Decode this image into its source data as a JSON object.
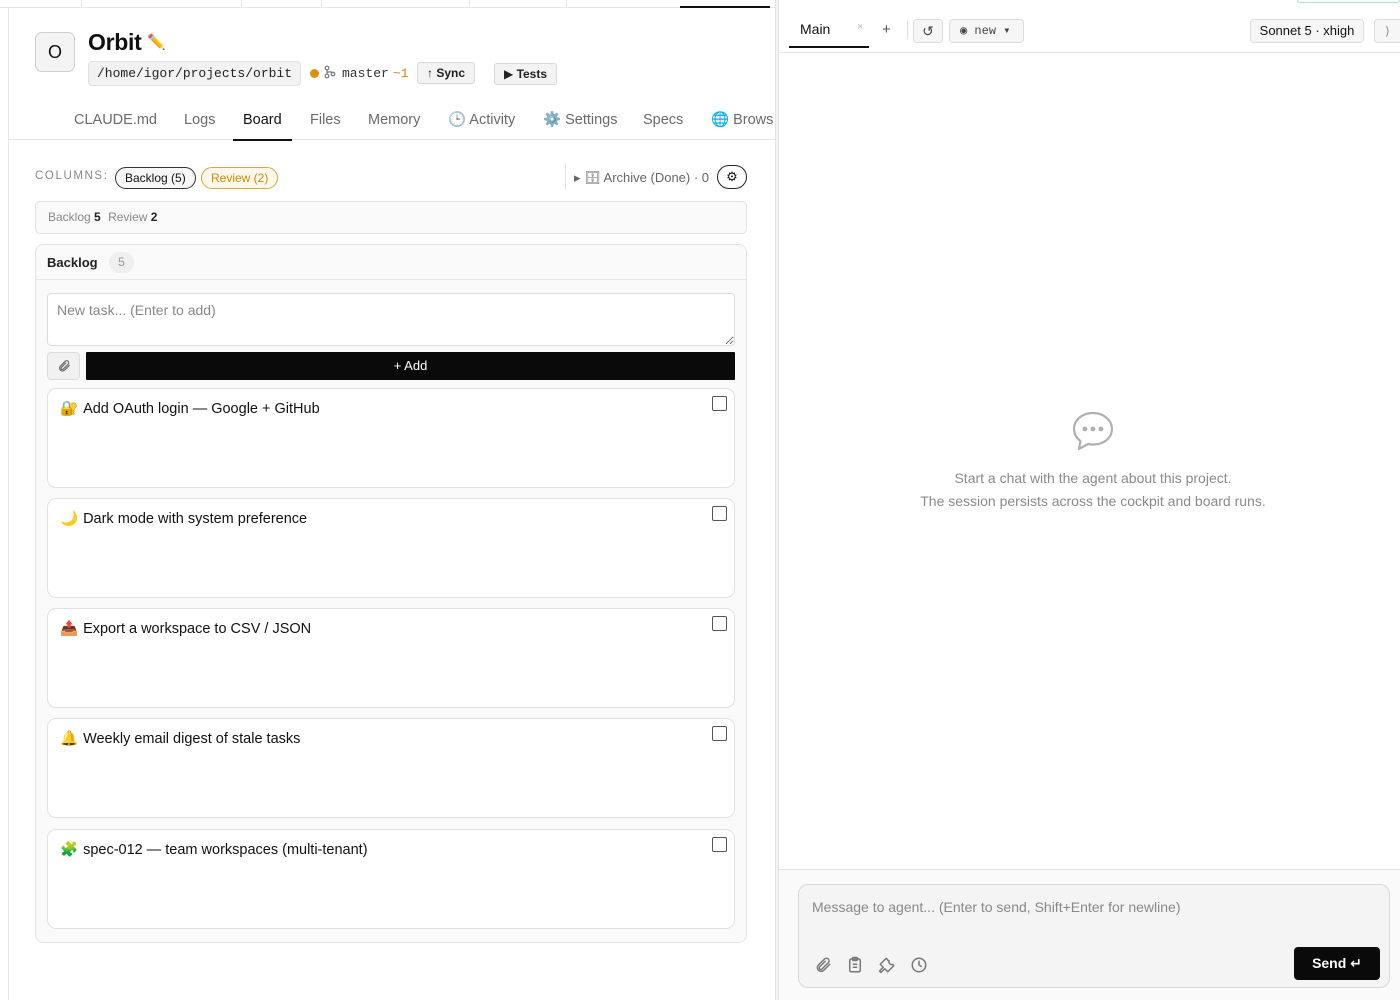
{
  "project": {
    "avatar_letter": "O",
    "name": "Orbit",
    "path": "/home/igor/projects/orbit",
    "branch": "master",
    "branch_ahead": "~1",
    "sync_label": "↑ Sync",
    "tests_label": "▶ Tests"
  },
  "tabs": [
    {
      "label": "CLAUDE.md"
    },
    {
      "label": "Logs"
    },
    {
      "label": "Board",
      "active": true
    },
    {
      "label": "Files"
    },
    {
      "label": "Memory"
    },
    {
      "label": "🕒 Activity"
    },
    {
      "label": "⚙️ Settings"
    },
    {
      "label": "Specs"
    },
    {
      "label": "🌐 Brows"
    }
  ],
  "board": {
    "columns_label": "COLUMNS:",
    "chips": {
      "backlog": "Backlog (5)",
      "review": "Review (2)"
    },
    "archive_label": "▸ 🗄 Archive (Done) · 0",
    "summary": {
      "backlog_label": "Backlog",
      "backlog_count": "5",
      "review_label": "Review",
      "review_count": "2"
    },
    "column": {
      "name": "Backlog",
      "count": "5",
      "new_task_placeholder": "New task... (Enter to add)",
      "add_label": "+ Add",
      "cards": [
        {
          "emoji": "🔐",
          "text": "Add OAuth login — Google + GitHub"
        },
        {
          "emoji": "🌙",
          "text": "Dark mode with system preference"
        },
        {
          "emoji": "📤",
          "text": "Export a workspace to CSV / JSON"
        },
        {
          "emoji": "🔔",
          "text": "Weekly email digest of stale tasks"
        },
        {
          "emoji": "🧩",
          "text": "spec-012 — team workspaces (multi-tenant)"
        }
      ]
    }
  },
  "chat": {
    "tab_label": "Main",
    "tab_close": "×",
    "new_tab": "+",
    "refresh": "↺",
    "session_label": "◉ new ▾",
    "model_label": "Sonnet 5 · xhigh",
    "collapse": "⟩",
    "empty_line1": "Start a chat with the agent about this project.",
    "empty_line2": "The session persists across the cockpit and board runs.",
    "composer_placeholder": "Message to agent... (Enter to send, Shift+Enter for newline)",
    "send_label": "Send ↵"
  }
}
